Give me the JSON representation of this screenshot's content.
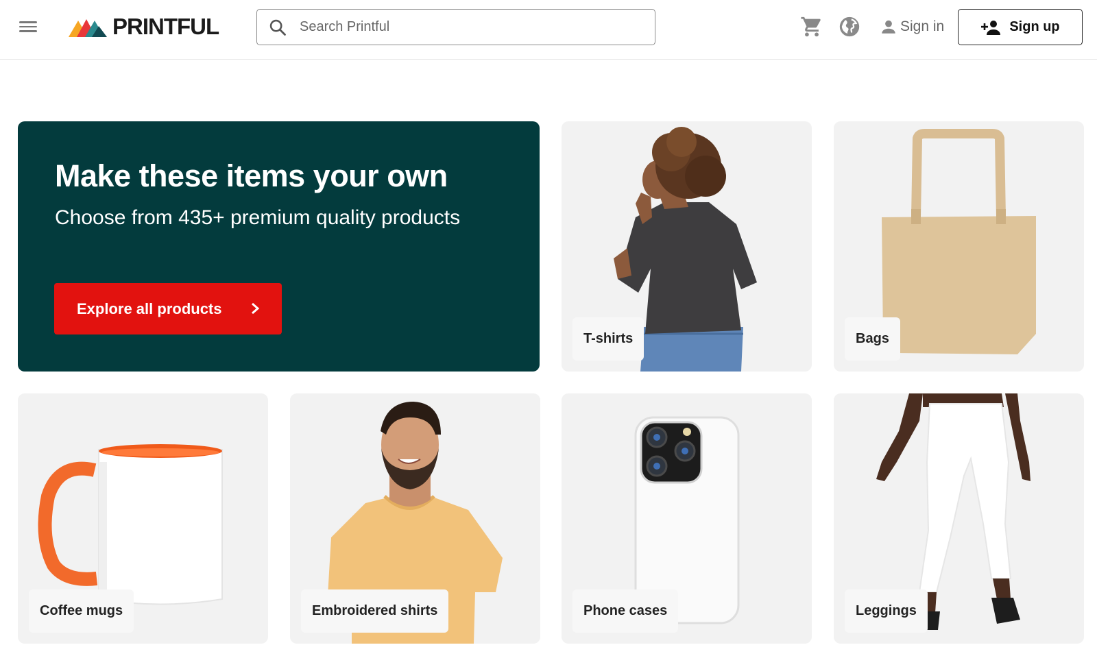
{
  "header": {
    "logo_text": "PRINTFUL",
    "search_placeholder": "Search Printful",
    "signin_label": "Sign in",
    "signup_label": "Sign up",
    "icons": [
      "menu-icon",
      "search-icon",
      "cart-icon",
      "globe-icon",
      "user-icon",
      "add-user-icon"
    ]
  },
  "hero": {
    "title": "Make these items your own",
    "subtitle": "Choose from 435+ premium quality products",
    "cta_label": "Explore all products",
    "background_color": "#033b3d",
    "cta_color": "#e2120f"
  },
  "categories": [
    {
      "label": "T-shirts"
    },
    {
      "label": "Bags"
    },
    {
      "label": "Coffee mugs"
    },
    {
      "label": "Embroidered shirts"
    },
    {
      "label": "Phone cases"
    },
    {
      "label": "Leggings"
    }
  ]
}
